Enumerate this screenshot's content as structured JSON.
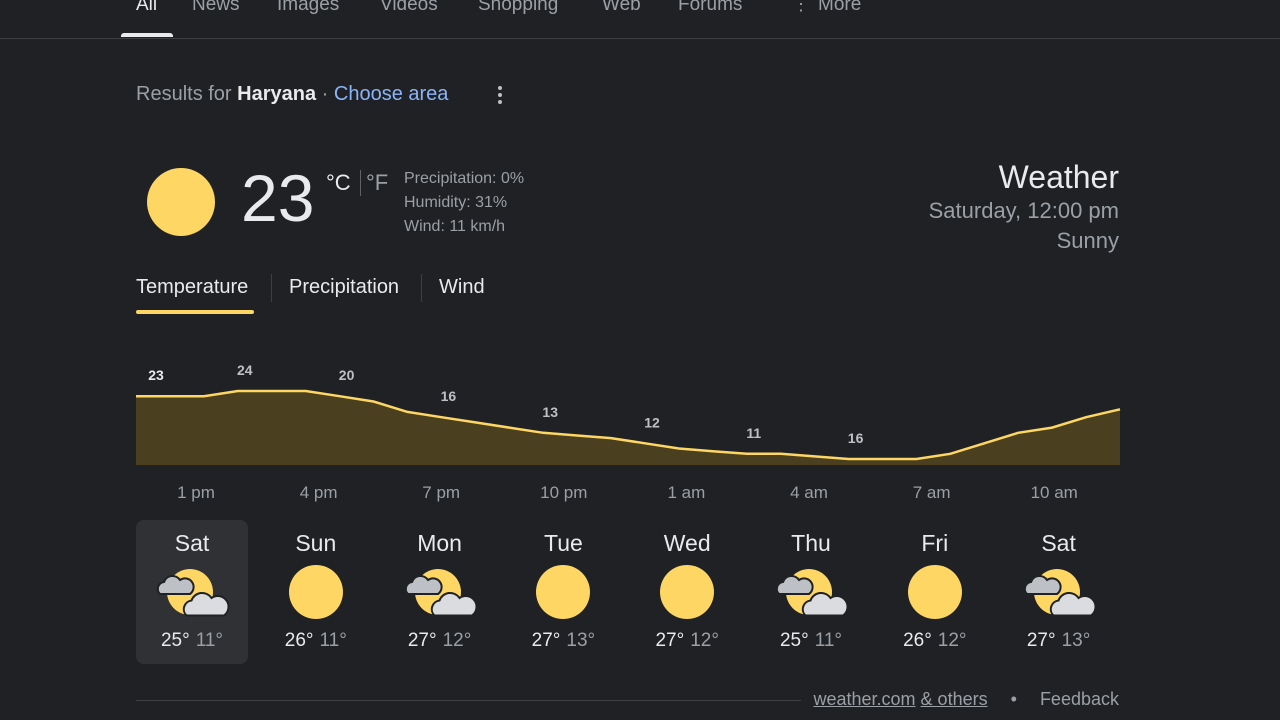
{
  "nav": {
    "tabs": [
      "All",
      "News",
      "Images",
      "Videos",
      "Shopping",
      "Web",
      "Forums",
      "More"
    ],
    "active": "All"
  },
  "results": {
    "prefix": "Results for",
    "location": "Haryana",
    "separator": "·",
    "choose_area": "Choose area"
  },
  "current": {
    "temp": "23",
    "unit_c": "°C",
    "unit_f": "°F",
    "precipitation": "Precipitation: 0%",
    "humidity": "Humidity: 31%",
    "wind": "Wind: 11 km/h",
    "icon": "sun-icon"
  },
  "header": {
    "title": "Weather",
    "datetime": "Saturday, 12:00 pm",
    "condition": "Sunny"
  },
  "tabs": [
    "Temperature",
    "Precipitation",
    "Wind"
  ],
  "active_tab": "Temperature",
  "colors": {
    "accent": "#fdd663",
    "chart_fill": "#4a4020",
    "link": "#8ab4f8",
    "background": "#202124"
  },
  "chart_data": {
    "type": "area",
    "x_labels": [
      "1 pm",
      "4 pm",
      "7 pm",
      "10 pm",
      "1 am",
      "4 am",
      "7 am",
      "10 am"
    ],
    "labels": [
      "23",
      "24",
      "20",
      "16",
      "13",
      "12",
      "11",
      "16"
    ],
    "values": [
      23,
      23,
      23,
      24,
      24,
      24,
      23,
      22,
      20,
      19,
      18,
      17,
      16,
      15.5,
      15,
      14,
      13,
      12.5,
      12,
      12,
      11.5,
      11,
      11,
      11,
      12,
      14,
      16,
      17,
      19,
      20.5
    ],
    "hours_per_point": 1,
    "title": "",
    "xlabel": "",
    "ylabel": ""
  },
  "days": [
    {
      "name": "Sat",
      "hi": "25°",
      "lo": "11°",
      "icon": "partly-cloudy-icon",
      "selected": true
    },
    {
      "name": "Sun",
      "hi": "26°",
      "lo": "11°",
      "icon": "sun-icon",
      "selected": false
    },
    {
      "name": "Mon",
      "hi": "27°",
      "lo": "12°",
      "icon": "partly-cloudy-icon",
      "selected": false
    },
    {
      "name": "Tue",
      "hi": "27°",
      "lo": "13°",
      "icon": "sun-icon",
      "selected": false
    },
    {
      "name": "Wed",
      "hi": "27°",
      "lo": "12°",
      "icon": "sun-icon",
      "selected": false
    },
    {
      "name": "Thu",
      "hi": "25°",
      "lo": "11°",
      "icon": "partly-cloudy-icon",
      "selected": false
    },
    {
      "name": "Fri",
      "hi": "26°",
      "lo": "12°",
      "icon": "sun-icon",
      "selected": false
    },
    {
      "name": "Sat",
      "hi": "27°",
      "lo": "13°",
      "icon": "partly-cloudy-icon",
      "selected": false
    }
  ],
  "footer": {
    "source": "weather.com",
    "others": "& others",
    "separator": "•",
    "feedback": "Feedback"
  }
}
